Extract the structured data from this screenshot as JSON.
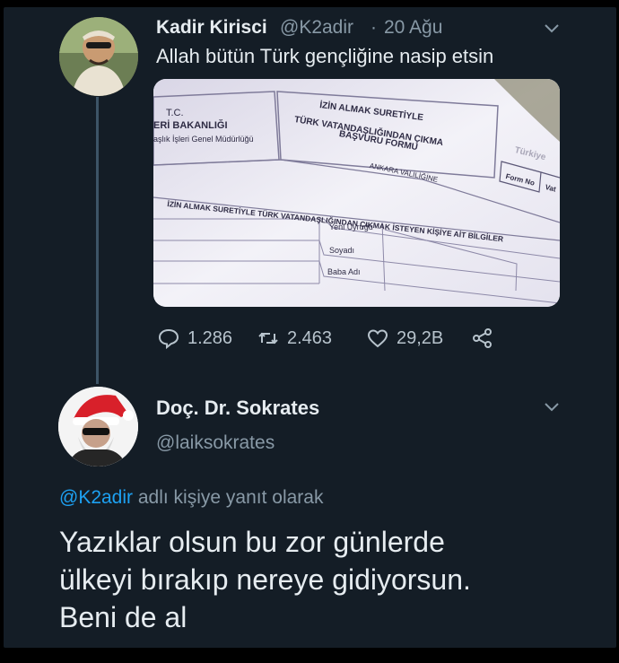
{
  "tweet1": {
    "author_name": "Kadir Kirisci",
    "handle": "@K2adir",
    "separator": "·",
    "date": "20 Ağu",
    "text": "Allah bütün Türk gençliğine nasip etsin",
    "menu_icon": "chevron-down-icon",
    "image": {
      "header_left": [
        "T.C.",
        "ERİ BAKANLIĞI",
        "aşlık İşleri Genel Müdürlüğü"
      ],
      "header_center": [
        "İZİN ALMAK SURETİYLE",
        "TÜRK VATANDAŞLIĞINDAN ÇIKMA",
        "BAŞVURU FORMU"
      ],
      "header_right": "Türkiye",
      "form_no_label": "Form No",
      "vat_label": "Vat",
      "office": "ANKARA VALİLİĞİNE",
      "section_title": "İZİN ALMAK SURETİYLE TÜRK VATANDAŞLIĞINDAN ÇIKMAK İSTEYEN KİŞİYE AİT BİLGİLER",
      "fields": [
        "Yeni Uyruğu",
        "Soyadı",
        "Baba Adı"
      ]
    },
    "actions": {
      "replies": "1.286",
      "retweets": "2.463",
      "likes": "29,2B"
    }
  },
  "tweet2": {
    "author_name": "Doç. Dr. Sokrates",
    "handle": "@laiksokrates",
    "reply_mention": "@K2adir",
    "reply_suffix": " adlı kişiye yanıt olarak",
    "body_lines": [
      "Yazıklar olsun bu zor günlerde",
      "ülkeyi bırakıp nereye gidiyorsun.",
      "Beni de al"
    ],
    "menu_icon": "chevron-down-icon"
  },
  "colors": {
    "background": "#141d26",
    "primary_text": "#e6ecf0",
    "secondary_text": "#8899a6",
    "link": "#1da1f2"
  }
}
